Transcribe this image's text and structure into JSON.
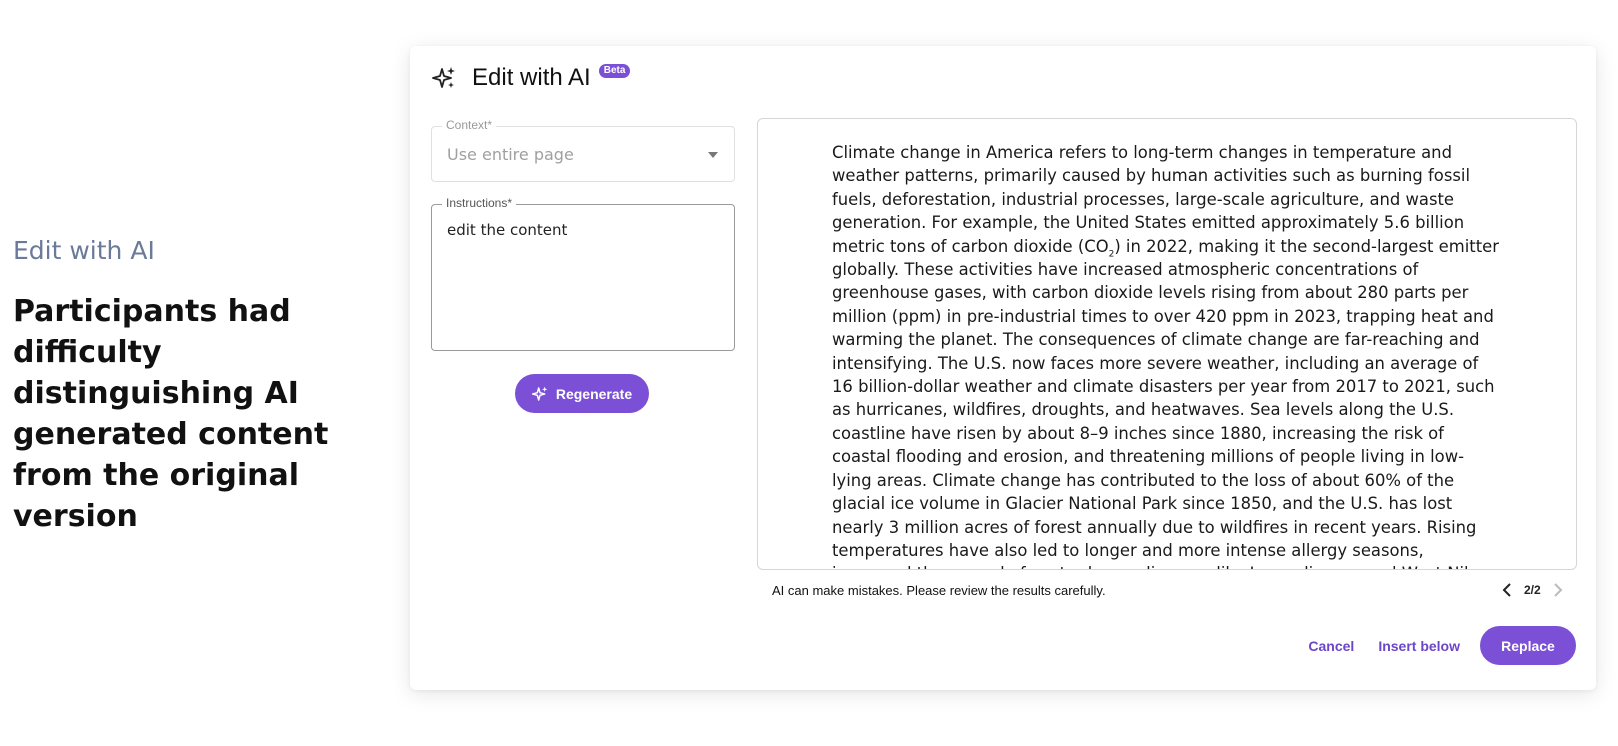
{
  "caption": {
    "kicker": "Edit with AI",
    "title": "Participants had difficulty distinguishing AI generated content from the original version"
  },
  "dialog": {
    "title": "Edit with AI",
    "badge": "Beta",
    "context": {
      "label": "Context*",
      "value": "Use entire page"
    },
    "instructions": {
      "label": "Instructions*",
      "value": "edit the content"
    },
    "regenerate_label": "Regenerate",
    "result": {
      "part1": "Climate change in America refers to long-term changes in temperature and weather patterns, primarily caused by human activities such as burning fossil fuels, deforestation, industrial processes, large-scale agriculture, and waste generation. For example, the United States emitted approximately 5.6 billion metric tons of carbon dioxide (CO",
      "subscript": "2",
      "part2": ") in 2022, making it the second-largest emitter globally. These activities have increased atmospheric concentrations of greenhouse gases, with carbon dioxide levels rising from about 280 parts per million (ppm) in pre-industrial times to over 420 ppm in 2023, trapping heat and warming the planet. The consequences of climate change are far-reaching and intensifying. The U.S. now faces more severe weather, including an average of 16 billion-dollar weather and climate disasters per year from 2017 to 2021, such as hurricanes, wildfires, droughts, and heatwaves. Sea levels along the U.S. coastline have risen by about 8–9 inches since 1880, increasing the risk of coastal flooding and erosion, and threatening millions of people living in low-lying areas. Climate change has contributed to the loss of about 60% of the glacial ice volume in Glacier National Park since 1850, and the U.S. has lost nearly 3 million acres of forest annually due to wildfires in recent years. Rising temperatures have also led to longer and more intense allergy seasons, increased the spread of vector-borne diseases like Lyme disease and West Nile virus, and worsened air quality."
    },
    "disclaimer": "AI can make mistakes. Please review the results carefully.",
    "pager": {
      "count": "2/2"
    },
    "actions": {
      "cancel_label": "Cancel",
      "insert_below_label": "Insert below",
      "replace_label": "Replace"
    }
  },
  "colors": {
    "accent": "#7b4fd6",
    "link": "#6b46c8"
  },
  "icons": [
    "sparkle-icon",
    "chevron-down-icon",
    "chevron-left-icon",
    "chevron-right-icon"
  ]
}
